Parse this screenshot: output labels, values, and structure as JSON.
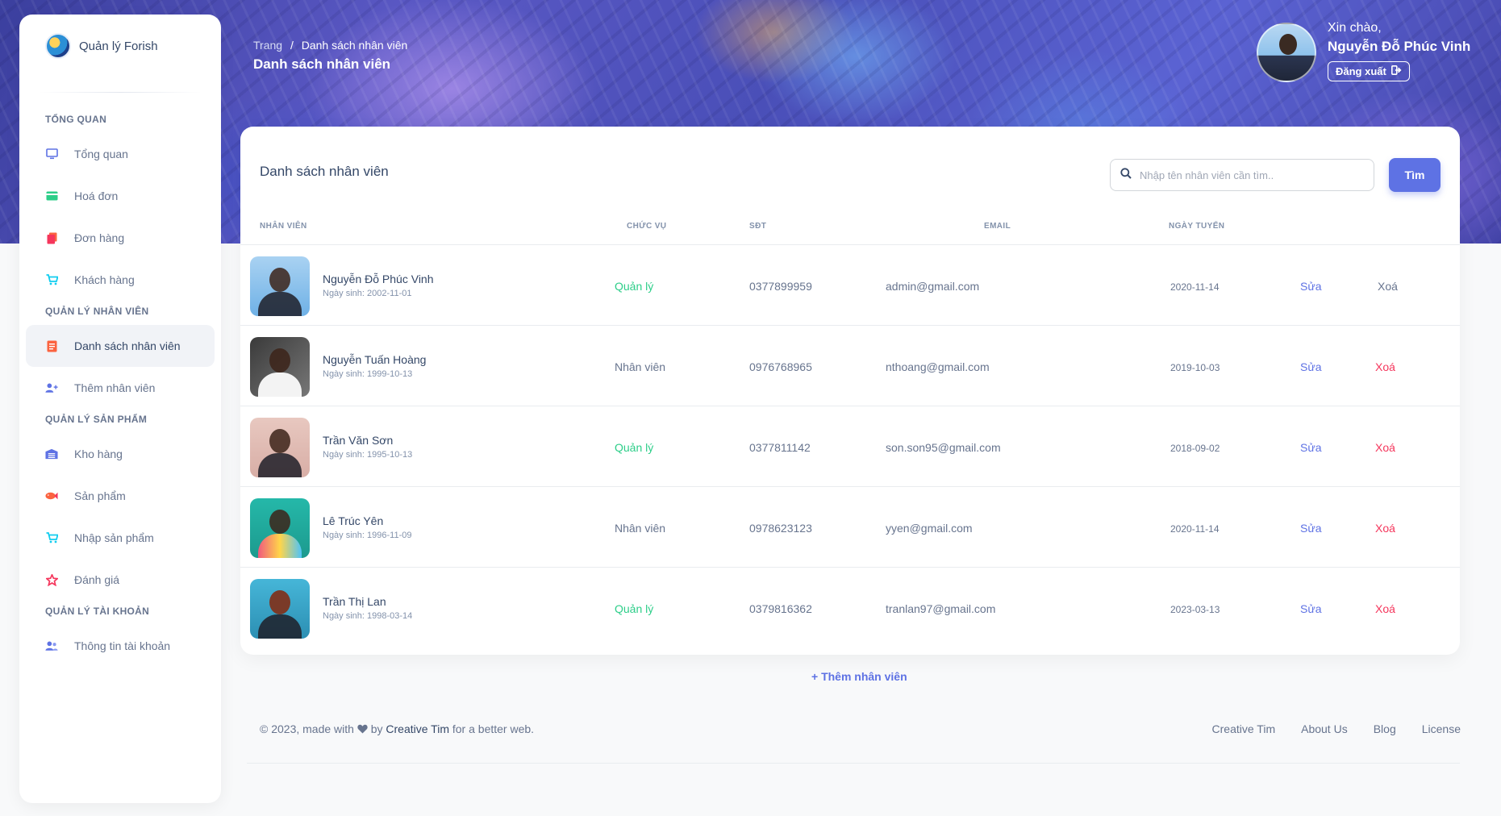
{
  "brand": {
    "name": "Quản lý Forish"
  },
  "sidebar": {
    "sections": [
      {
        "title": "TỔNG QUAN",
        "items": [
          {
            "label": "Tổng quan",
            "icon": "monitor-icon"
          },
          {
            "label": "Hoá đơn",
            "icon": "credit-card-icon"
          },
          {
            "label": "Đơn hàng",
            "icon": "copy-icon"
          },
          {
            "label": "Khách hàng",
            "icon": "cart-icon"
          }
        ]
      },
      {
        "title": "QUẢN LÝ NHÂN VIÊN",
        "items": [
          {
            "label": "Danh sách nhân viên",
            "icon": "list-icon",
            "active": true
          },
          {
            "label": "Thêm nhân viên",
            "icon": "user-plus-icon"
          }
        ]
      },
      {
        "title": "QUẢN LÝ SẢN PHẨM",
        "items": [
          {
            "label": "Kho hàng",
            "icon": "warehouse-icon"
          },
          {
            "label": "Sản phẩm",
            "icon": "fish-icon"
          },
          {
            "label": "Nhập sản phẩm",
            "icon": "cart-icon"
          },
          {
            "label": "Đánh giá",
            "icon": "star-icon"
          }
        ]
      },
      {
        "title": "QUẢN LÝ TÀI KHOẢN",
        "items": [
          {
            "label": "Thông tin tài khoản",
            "icon": "user-icon"
          }
        ]
      }
    ]
  },
  "header": {
    "breadcrumb_root": "Trang",
    "breadcrumb_sep": "/",
    "breadcrumb_current": "Danh sách nhân viên",
    "title": "Danh sách nhân viên"
  },
  "user": {
    "greeting": "Xin chào,",
    "name": "Nguyễn Đỗ Phúc Vinh",
    "logout_label": "Đăng xuất"
  },
  "card": {
    "title": "Danh sách nhân viên",
    "search_placeholder": "Nhập tên nhân viên cần tìm..",
    "search_button": "Tìm"
  },
  "table": {
    "headers": {
      "employee": "NHÂN VIÊN",
      "role": "CHỨC VỤ",
      "phone": "SĐT",
      "email": "EMAIL",
      "hired": "NGÀY TUYỂN"
    },
    "edit_label": "Sửa",
    "delete_label": "Xoá",
    "rows": [
      {
        "name": "Nguyễn Đỗ Phúc Vinh",
        "dob": "Ngày sinh: 2002-11-01",
        "role": "Quản lý",
        "phone": "0377899959",
        "email": "admin@gmail.com",
        "hired": "2020-11-14"
      },
      {
        "name": "Nguyễn Tuấn Hoàng",
        "dob": "Ngày sinh: 1999-10-13",
        "role": "Nhân viên",
        "phone": "0976768965",
        "email": "nthoang@gmail.com",
        "hired": "2019-10-03"
      },
      {
        "name": "Trần Văn Sơn",
        "dob": "Ngày sinh: 1995-10-13",
        "role": "Quản lý",
        "phone": "0377811142",
        "email": "son.son95@gmail.com",
        "hired": "2018-09-02"
      },
      {
        "name": "Lê Trúc Yên",
        "dob": "Ngày sinh: 1996-11-09",
        "role": "Nhân viên",
        "phone": "0978623123",
        "email": "yyen@gmail.com",
        "hired": "2020-11-14"
      },
      {
        "name": "Trần Thị Lan",
        "dob": "Ngày sinh: 1998-03-14",
        "role": "Quản lý",
        "phone": "0379816362",
        "email": "tranlan97@gmail.com",
        "hired": "2023-03-13"
      }
    ]
  },
  "add_link": "+ Thêm nhân viên",
  "footer": {
    "prefix": "© 2023, made with",
    "by": "by",
    "author": "Creative Tim",
    "suffix": "for a better web.",
    "links": [
      "Creative Tim",
      "About Us",
      "Blog",
      "License"
    ]
  },
  "colors": {
    "primary": "#5e72e4",
    "success": "#2dce89",
    "danger": "#f5365c",
    "text": "#344767",
    "muted": "#67748e"
  }
}
